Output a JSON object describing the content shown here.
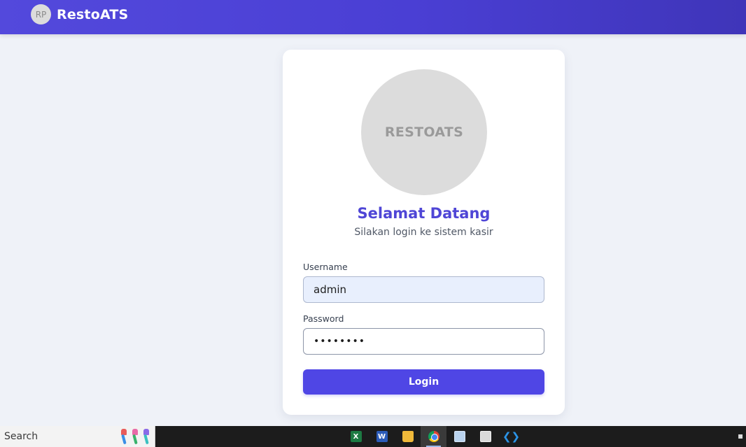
{
  "header": {
    "badge_initials": "RP",
    "brand": "RestoATS"
  },
  "card": {
    "logo_text": "RESTOATS",
    "title": "Selamat Datang",
    "subtitle": "Silakan login ke sistem kasir",
    "username_label": "Username",
    "username_value": "admin",
    "password_label": "Password",
    "password_value": "••••••••",
    "login_label": "Login"
  },
  "taskbar": {
    "search_label": "Search",
    "apps": [
      {
        "name": "excel-icon",
        "glyph": "X"
      },
      {
        "name": "word-icon",
        "glyph": "W"
      },
      {
        "name": "file-explorer-icon",
        "glyph": ""
      },
      {
        "name": "chrome-icon",
        "glyph": ""
      },
      {
        "name": "notepad-icon",
        "glyph": ""
      },
      {
        "name": "printer-icon",
        "glyph": ""
      },
      {
        "name": "vscode-icon",
        "glyph": "❮❯"
      }
    ]
  },
  "colors": {
    "header_gradient_start": "#5349dc",
    "header_gradient_end": "#3f35b9",
    "accent": "#4f46e5",
    "title": "#4f46d6",
    "page_bg": "#eff2f8",
    "username_fill": "#e8effd"
  }
}
